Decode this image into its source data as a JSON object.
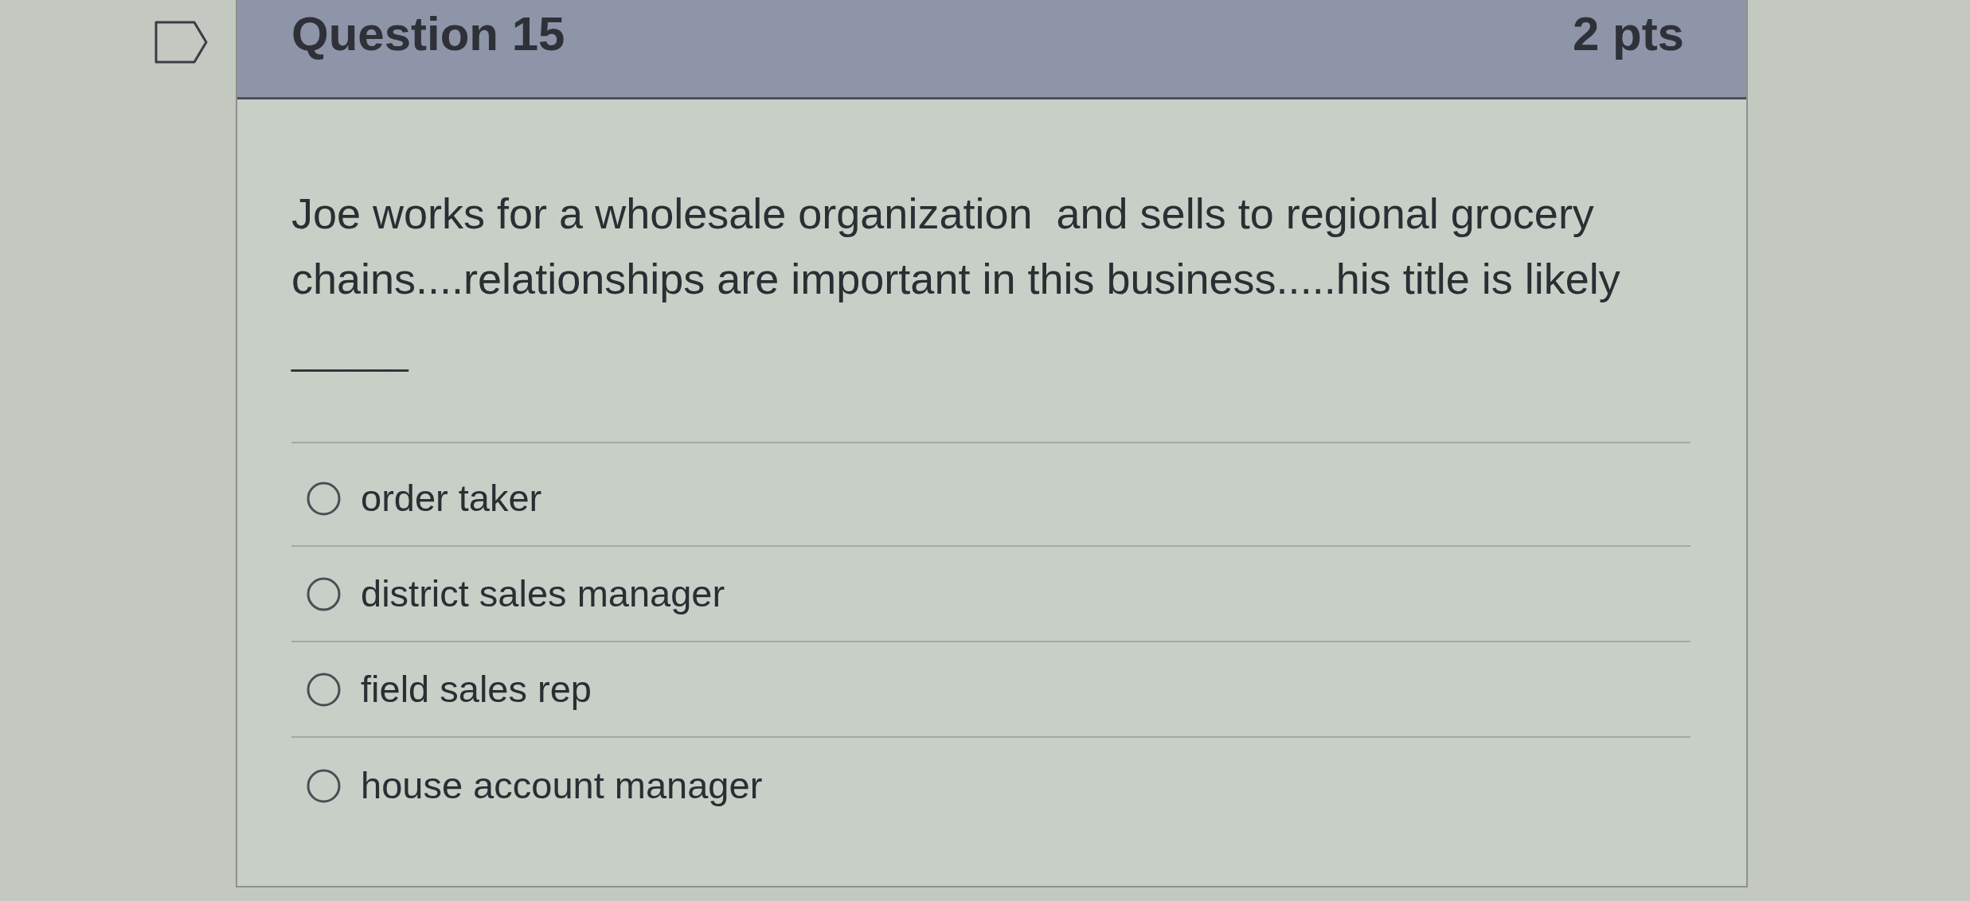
{
  "question": {
    "title": "Question 15",
    "points": "2 pts",
    "text": "Joe works for a wholesale organization  and sells to regional grocery chains....relationships are important in this business.....his title is likely",
    "blank": "______",
    "options": [
      {
        "label": "order taker",
        "selected": false
      },
      {
        "label": "district sales manager",
        "selected": false
      },
      {
        "label": "field sales rep",
        "selected": false
      },
      {
        "label": "house account manager",
        "selected": false
      }
    ]
  }
}
